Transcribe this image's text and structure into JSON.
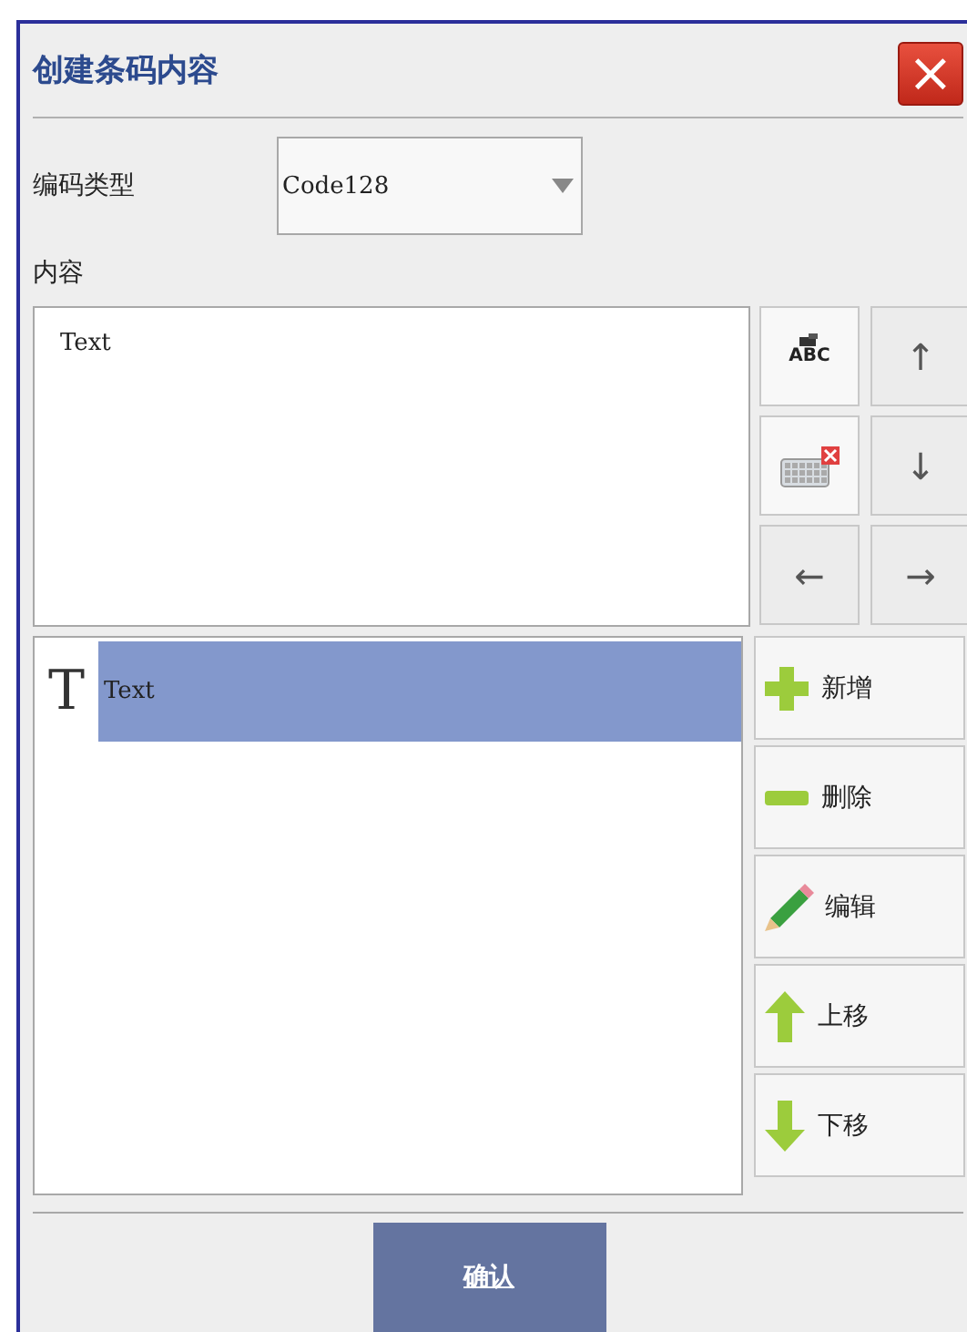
{
  "window": {
    "title": "创建条码内容",
    "close": "×"
  },
  "encoding": {
    "label": "编码类型",
    "value": "Code128"
  },
  "content": {
    "label": "内容",
    "value": "Text"
  },
  "tools": [
    {
      "kind": "abc",
      "text": "ABC"
    },
    {
      "kind": "up",
      "text": "↑"
    },
    {
      "kind": "keyboard"
    },
    {
      "kind": "down",
      "text": "↓"
    },
    {
      "kind": "left",
      "text": "←"
    },
    {
      "kind": "right",
      "text": "→"
    }
  ],
  "items": [
    {
      "icon": "T",
      "label": "Text",
      "selected": true
    }
  ],
  "actions": [
    {
      "kind": "add",
      "label": "新增"
    },
    {
      "kind": "delete",
      "label": "删除"
    },
    {
      "kind": "edit",
      "label": "编辑"
    },
    {
      "kind": "move-up",
      "label": "上移"
    },
    {
      "kind": "move-down",
      "label": "下移"
    }
  ],
  "confirm": "确认"
}
